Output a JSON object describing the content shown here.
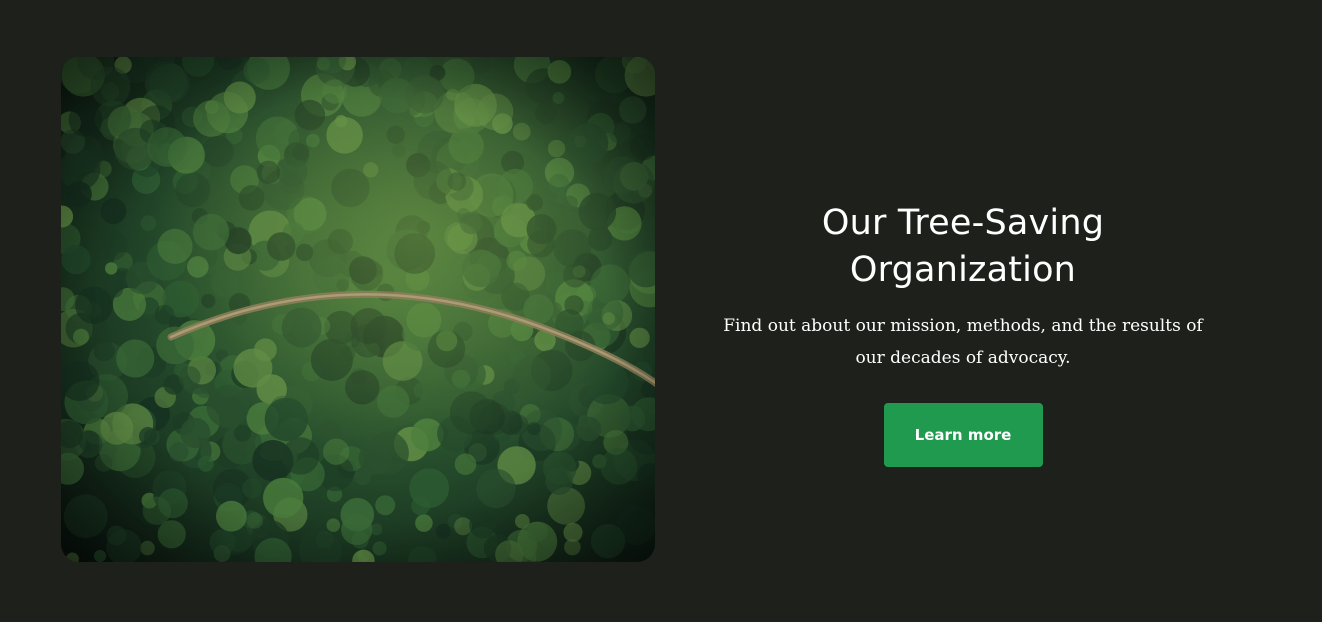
{
  "hero": {
    "image_name": "aerial-forest-road",
    "title": "Our Tree-Saving Organization",
    "description": "Find out about our mission, methods, and the results of our decades of advocacy.",
    "cta_label": "Learn more"
  },
  "colors": {
    "background": "#1d201b",
    "accent": "#209a4f",
    "text": "#ffffff"
  }
}
